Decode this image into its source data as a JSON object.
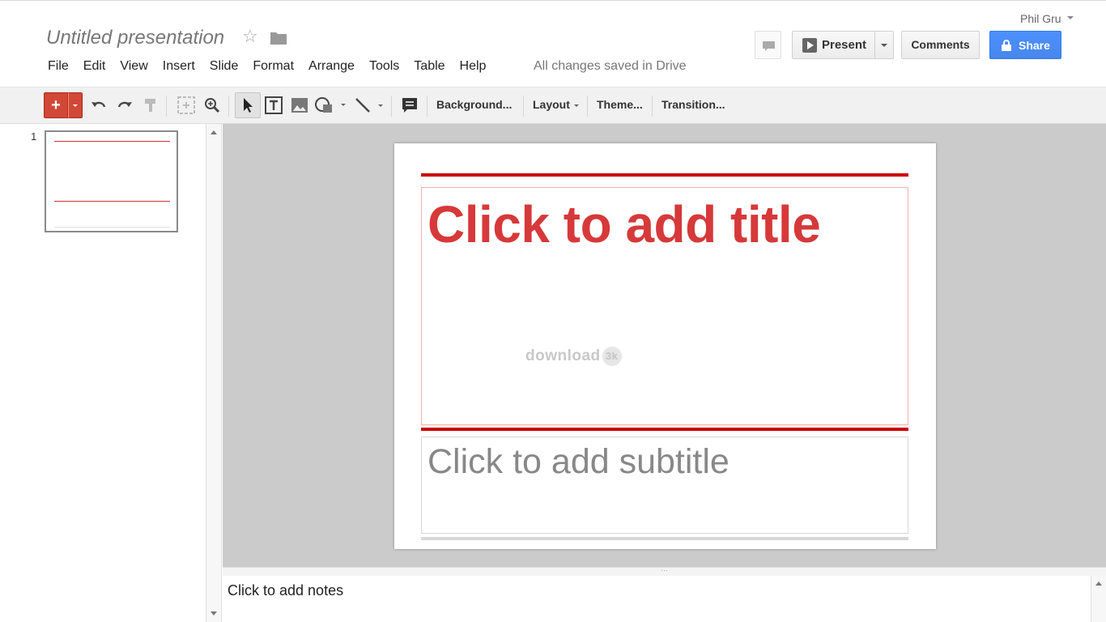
{
  "header": {
    "doc_title": "Untitled presentation",
    "save_status": "All changes saved in Drive",
    "user_name": "Phil Gru"
  },
  "menu": [
    "File",
    "Edit",
    "View",
    "Insert",
    "Slide",
    "Format",
    "Arrange",
    "Tools",
    "Table",
    "Help"
  ],
  "actions": {
    "present": "Present",
    "comments": "Comments",
    "share": "Share"
  },
  "toolbar": {
    "new_slide": "+",
    "background": "Background...",
    "layout": "Layout",
    "theme": "Theme...",
    "transition": "Transition..."
  },
  "filmstrip": {
    "slide_number": "1"
  },
  "slide": {
    "title_placeholder": "Click to add title",
    "subtitle_placeholder": "Click to add subtitle",
    "watermark": "download",
    "watermark_badge": "3k"
  },
  "notes": {
    "placeholder": "Click to add notes"
  },
  "colors": {
    "accent_red": "#d14836",
    "title_red": "#d6393a",
    "share_blue": "#4d90fe"
  },
  "icons": [
    "star-icon",
    "folder-icon",
    "chat-icon",
    "play-icon",
    "lock-icon",
    "undo-icon",
    "redo-icon",
    "paint-format-icon",
    "zoom-fit-icon",
    "zoom-icon",
    "cursor-icon",
    "textbox-icon",
    "image-icon",
    "shape-icon",
    "line-icon",
    "comment-icon"
  ]
}
